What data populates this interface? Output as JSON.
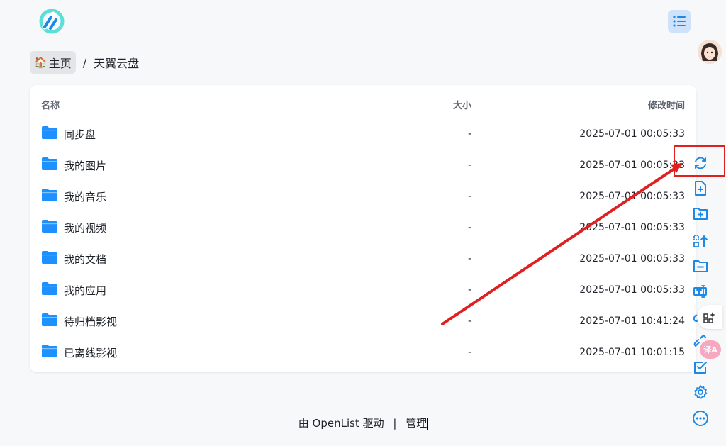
{
  "breadcrumb": {
    "home_label": "主页",
    "separator": "/",
    "current": "天翼云盘"
  },
  "table": {
    "headers": {
      "name": "名称",
      "size": "大小",
      "modified": "修改时间"
    },
    "rows": [
      {
        "name": "同步盘",
        "size": "-",
        "modified": "2025-07-01 00:05:33"
      },
      {
        "name": "我的图片",
        "size": "-",
        "modified": "2025-07-01 00:05:33"
      },
      {
        "name": "我的音乐",
        "size": "-",
        "modified": "2025-07-01 00:05:33"
      },
      {
        "name": "我的视频",
        "size": "-",
        "modified": "2025-07-01 00:05:33"
      },
      {
        "name": "我的文档",
        "size": "-",
        "modified": "2025-07-01 00:05:33"
      },
      {
        "name": "我的应用",
        "size": "-",
        "modified": "2025-07-01 00:05:33"
      },
      {
        "name": "待归档影视",
        "size": "-",
        "modified": "2025-07-01 10:41:24"
      },
      {
        "name": "已离线影视",
        "size": "-",
        "modified": "2025-07-01 10:01:15"
      }
    ]
  },
  "toolbar": {
    "items": [
      "refresh-icon",
      "new-file-icon",
      "new-folder-icon",
      "recursive-move-icon",
      "remove-empty-folder-icon",
      "batch-rename-icon",
      "upload-icon",
      "link-icon",
      "select-icon",
      "settings-icon",
      "more-icon"
    ]
  },
  "footer": {
    "powered_by": "由 OpenList 驱动",
    "separator": "|",
    "manage": "管理"
  },
  "translate_badge": "译A",
  "colors": {
    "accent": "#1e88e5",
    "folder": "#1e90ff",
    "annotation": "#e02020"
  }
}
